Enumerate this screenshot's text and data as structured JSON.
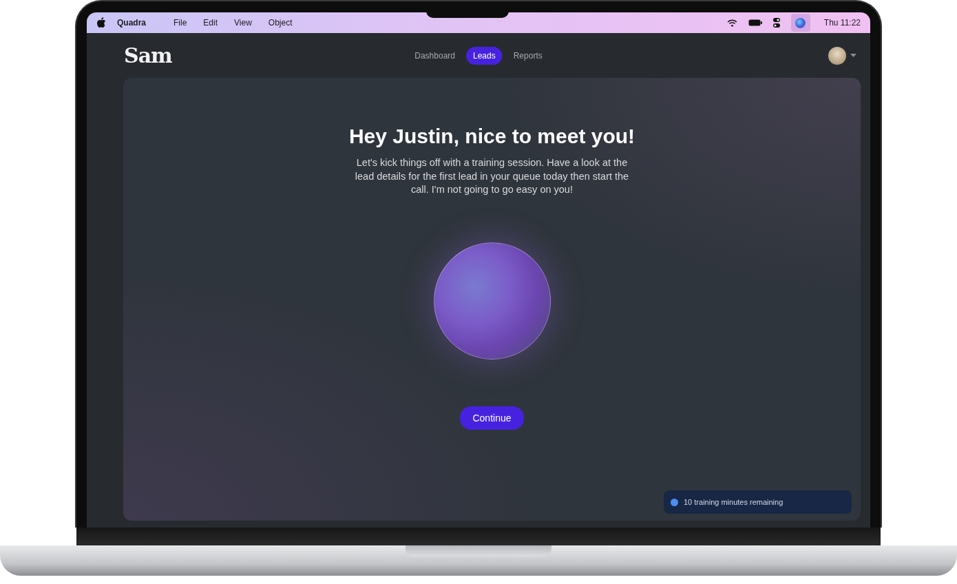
{
  "menu_bar": {
    "app_name": "Quadra",
    "menus": [
      "File",
      "Edit",
      "View",
      "Object"
    ],
    "clock": "Thu 11:22"
  },
  "header": {
    "logo": "Sam",
    "nav": [
      {
        "label": "Dashboard",
        "selected": false
      },
      {
        "label": "Leads",
        "selected": true
      },
      {
        "label": "Reports",
        "selected": false
      }
    ]
  },
  "welcome": {
    "title": "Hey Justin, nice to meet you!",
    "message": "Let's kick things off with a training session. Have a look at the lead details for the first lead in your queue today then start the call. I'm not going to go easy on you!",
    "button": "Continue"
  },
  "notice": {
    "text": "10 training minutes remaining"
  }
}
